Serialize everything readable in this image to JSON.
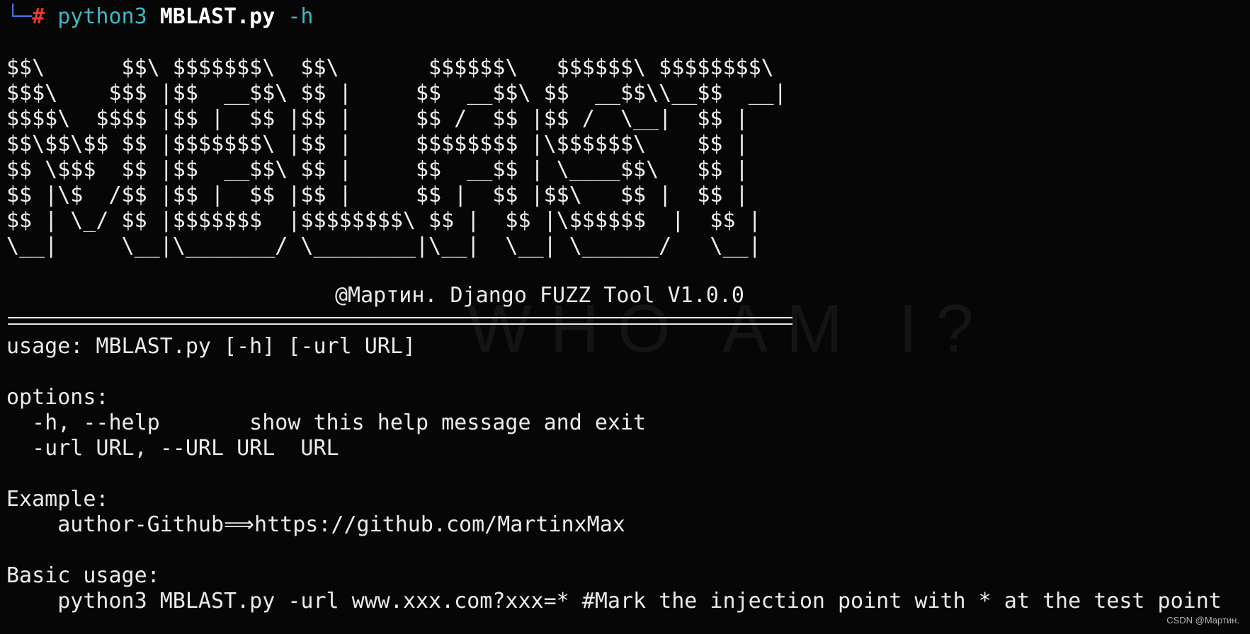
{
  "prompt": {
    "corner": "└─",
    "symbol": "#",
    "command": "python3",
    "script": "MBLAST.py",
    "flag": "-h"
  },
  "banner": {
    "lines": [
      "$$\\      $$\\ $$$$$$$\\  $$\\       $$$$$$\\   $$$$$$\\ $$$$$$$$\\",
      "$$$\\    $$$ |$$  __$$\\ $$ |     $$  __$$\\ $$  __$$\\\\__$$  __|",
      "$$$$\\  $$$$ |$$ |  $$ |$$ |     $$ /  $$ |$$ /  \\__|  $$ |",
      "$$\\$$\\$$ $$ |$$$$$$$\\ |$$ |     $$$$$$$$ |\\$$$$$$\\    $$ |",
      "$$ \\$$$  $$ |$$  __$$\\ $$ |     $$  __$$ | \\____$$\\   $$ |",
      "$$ |\\$  /$$ |$$ |  $$ |$$ |     $$ |  $$ |$$\\   $$ |  $$ |",
      "$$ | \\_/ $$ |$$$$$$$  |$$$$$$$$\\ $$ |  $$ |\\$$$$$$  |  $$ |",
      "\\__|     \\__|\\_______/ \\________|\\__|  \\__| \\______/   \\__|"
    ],
    "credit": "@Мартин. Django FUZZ Tool V1.0.0"
  },
  "help": {
    "usage": "usage: MBLAST.py [-h] [-url URL]",
    "options_header": "options:",
    "option_help": "  -h, --help       show this help message and exit",
    "option_url": "  -url URL, --URL URL  URL",
    "example_header": "Example:",
    "example_line": "    author-Github⟹https://github.com/MartinxMax",
    "basic_header": "Basic usage:",
    "basic_line": "    python3 MBLAST.py -url www.xxx.com?xxx=* #Mark the injection point with * at the test point"
  },
  "background_watermark": "WHO AM I?",
  "watermark": "CSDN @Мартин.",
  "colors": {
    "background": "#060606",
    "text": "#eaeaea",
    "prompt_corner": "#3b6fd8",
    "prompt_hash": "#e8372d",
    "command_cyan": "#3fb8c4"
  }
}
